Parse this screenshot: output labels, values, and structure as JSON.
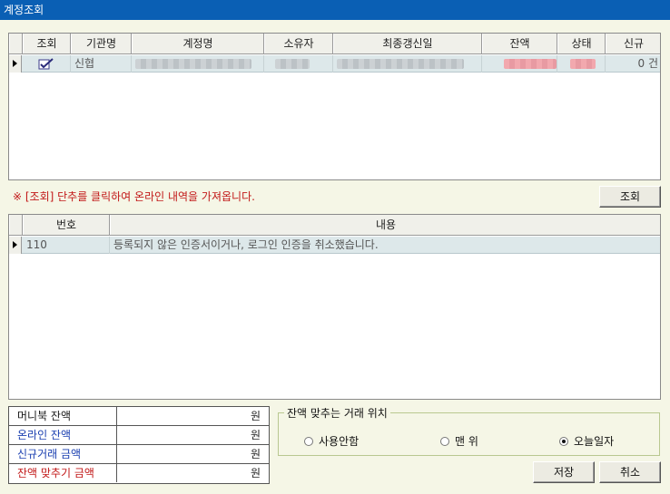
{
  "window": {
    "title": "계정조회"
  },
  "accounts_grid": {
    "columns": [
      "조회",
      "기관명",
      "계정명",
      "소유자",
      "최종갱신일",
      "잔액",
      "상태",
      "신규"
    ],
    "rows": [
      {
        "checked": true,
        "institution": "신협",
        "new_count": "0 건"
      }
    ]
  },
  "notice": "※ [조회] 단추를 클릭하여 온라인 내역을 가져옵니다.",
  "query_button": "조회",
  "messages_grid": {
    "columns": [
      "번호",
      "내용"
    ],
    "rows": [
      {
        "no": "110",
        "content": "등록되지 않은 인증서이거나, 로그인 인증을 취소했습니다."
      }
    ]
  },
  "summary": [
    {
      "label": "머니북 잔액",
      "unit": "원",
      "color": "#1a1a1a"
    },
    {
      "label": "온라인 잔액",
      "unit": "원",
      "color": "#1a3fb0"
    },
    {
      "label": "신규거래 금액",
      "unit": "원",
      "color": "#1a3fb0"
    },
    {
      "label": "잔액 맞추기 금액",
      "unit": "원",
      "color": "#c21818"
    }
  ],
  "balance_position": {
    "title": "잔액 맞추는 거래 위치",
    "options": [
      "사용안함",
      "맨 위",
      "오늘일자"
    ],
    "selected": "오늘일자"
  },
  "buttons": {
    "save": "저장",
    "cancel": "취소"
  }
}
